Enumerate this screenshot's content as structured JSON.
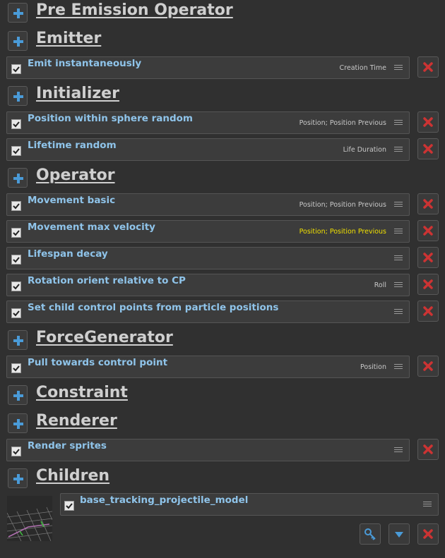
{
  "sections": {
    "pre_emission_operator": {
      "title": "Pre Emission Operator"
    },
    "emitter": {
      "title": "Emitter",
      "items": [
        {
          "label": "Emit instantaneously",
          "tag": "Creation Time",
          "checked": true
        }
      ]
    },
    "initializer": {
      "title": "Initializer",
      "items": [
        {
          "label": "Position within sphere random",
          "tag": "Position; Position Previous",
          "checked": true
        },
        {
          "label": "Lifetime random",
          "tag": "Life Duration",
          "checked": true
        }
      ]
    },
    "operator": {
      "title": "Operator",
      "items": [
        {
          "label": "Movement basic",
          "tag": "Position; Position Previous",
          "checked": true
        },
        {
          "label": "Movement max velocity",
          "tag": "Position; Position Previous",
          "checked": true,
          "tag_highlighted": true
        },
        {
          "label": "Lifespan decay",
          "tag": "",
          "checked": true
        },
        {
          "label": "Rotation orient relative to CP",
          "tag": "Roll",
          "checked": true
        },
        {
          "label": "Set child control points from particle positions",
          "tag": "",
          "checked": true
        }
      ]
    },
    "force_generator": {
      "title": "ForceGenerator",
      "items": [
        {
          "label": "Pull towards control point",
          "tag": "Position",
          "checked": true
        }
      ]
    },
    "constraint": {
      "title": "Constraint"
    },
    "renderer": {
      "title": "Renderer",
      "items": [
        {
          "label": "Render sprites",
          "tag": "",
          "checked": true
        }
      ]
    },
    "children": {
      "title": "Children",
      "items": [
        {
          "label": "base_tracking_projectile_model",
          "checked": true
        }
      ]
    }
  },
  "icons": {
    "add": "plus-icon",
    "delete": "red-x-icon",
    "check": "checkmark-icon",
    "drag": "drag-handle-icon",
    "edit": "key-icon",
    "dropdown": "chevron-down-icon"
  },
  "colors": {
    "background": "#303030",
    "row_background": "#3c3c3c",
    "row_label": "#8fc4ea",
    "section_title": "#cfcfcf",
    "highlight_tag": "#f0e000",
    "delete_red": "#cc3333",
    "add_blue": "#4a9bd8"
  }
}
